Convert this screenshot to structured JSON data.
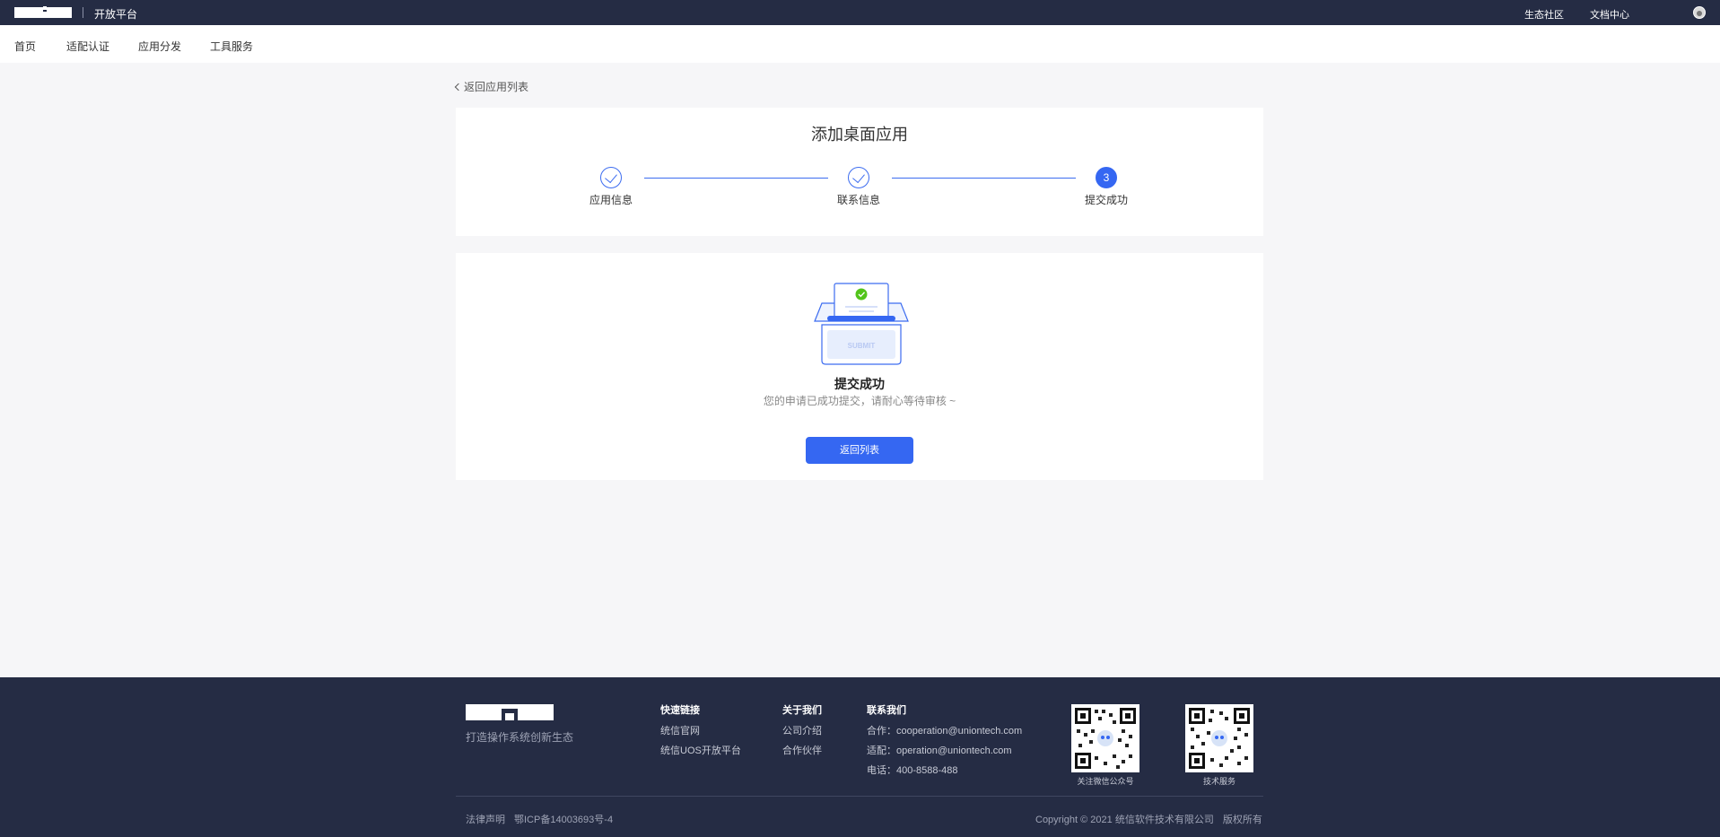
{
  "topbar": {
    "platform_label": "开放平台",
    "link_community": "生态社区",
    "link_docs": "文档中心"
  },
  "nav": {
    "items": [
      "首页",
      "适配认证",
      "应用分发",
      "工具服务"
    ]
  },
  "back_link": "返回应用列表",
  "steps_card": {
    "title": "添加桌面应用",
    "steps": [
      {
        "label": "应用信息",
        "state": "done"
      },
      {
        "label": "联系信息",
        "state": "done"
      },
      {
        "label": "提交成功",
        "state": "active",
        "number": "3"
      }
    ]
  },
  "success": {
    "illustration_text": "SUBMIT",
    "title": "提交成功",
    "description": "您的申请已成功提交，请耐心等待审核 ~",
    "button_label": "返回列表"
  },
  "footer": {
    "slogan": "打造操作系统创新生态",
    "quick_links": {
      "title": "快速链接",
      "items": [
        "统信官网",
        "统信UOS开放平台"
      ]
    },
    "about": {
      "title": "关于我们",
      "items": [
        "公司介绍",
        "合作伙伴"
      ]
    },
    "contact": {
      "title": "联系我们",
      "items": [
        "合作：cooperation@uniontech.com",
        "适配：operation@uniontech.com",
        "电话：400-8588-488"
      ]
    },
    "qr_wechat_caption": "关注微信公众号",
    "qr_support_caption": "技术服务",
    "legal": "法律声明",
    "icp": "鄂ICP备14003693号-4",
    "copyright": "Copyright © 2021 统信软件技术有限公司",
    "rights": "版权所有"
  },
  "colors": {
    "topbar_bg": "#252c44",
    "accent": "#3567f2",
    "page_bg": "#f6f6f8",
    "success_green": "#52c41a"
  }
}
